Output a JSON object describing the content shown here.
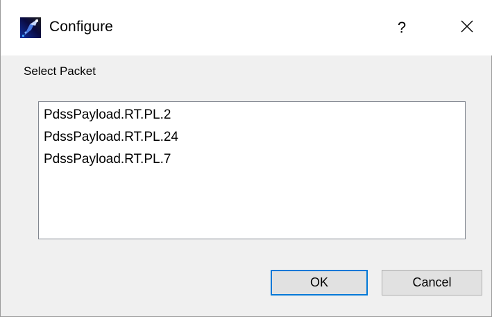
{
  "window": {
    "title": "Configure",
    "help_label": "?"
  },
  "icons": {
    "app": "app-logo-icon",
    "help": "help-icon",
    "close": "close-icon"
  },
  "section": {
    "label": "Select Packet"
  },
  "packets": [
    "PdssPayload.RT.PL.2",
    "PdssPayload.RT.PL.24",
    "PdssPayload.RT.PL.7"
  ],
  "buttons": {
    "ok": "OK",
    "cancel": "Cancel"
  },
  "colors": {
    "default_button_border": "#0078d7",
    "dialog_background": "#f0f0f0"
  }
}
